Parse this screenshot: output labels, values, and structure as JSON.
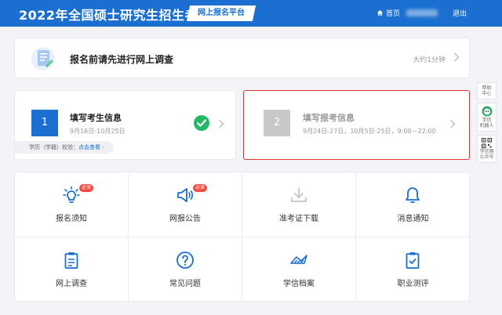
{
  "header": {
    "site_title": "2022年全国硕士研究生招生考试",
    "platform_badge": "网上报名平台",
    "home_label": "首页",
    "logout_label": "退出"
  },
  "survey": {
    "title": "报名前请先进行网上调查",
    "time_hint": "大约1分钟"
  },
  "steps": [
    {
      "number": "1",
      "title": "填写考生信息",
      "date": "9月16日-10月25日",
      "completed": true,
      "verify_prefix": "学历（学籍）校验：",
      "verify_link": "点击查看"
    },
    {
      "number": "2",
      "title": "填写报考信息",
      "date": "9月24日-27日，10月5日-25日，9:00－22:00",
      "completed": false
    }
  ],
  "side_tools": [
    {
      "label_1": "帮助",
      "label_2": "中心"
    },
    {
      "label_1": "学信",
      "label_2": "机器人"
    },
    {
      "label_1": "学信网",
      "label_2": "公众号"
    }
  ],
  "grid": [
    {
      "label": "报名须知",
      "icon": "lightbulb-icon",
      "tag": "必读"
    },
    {
      "label": "网报公告",
      "icon": "megaphone-icon",
      "tag": "必读"
    },
    {
      "label": "准考证下载",
      "icon": "download-icon",
      "tag": ""
    },
    {
      "label": "消息通知",
      "icon": "bell-icon",
      "tag": ""
    },
    {
      "label": "网上调查",
      "icon": "clipboard-icon",
      "tag": ""
    },
    {
      "label": "常见问题",
      "icon": "question-icon",
      "tag": ""
    },
    {
      "label": "学信档案",
      "icon": "archive-logo-icon",
      "tag": ""
    },
    {
      "label": "职业测评",
      "icon": "checklist-icon",
      "tag": ""
    }
  ],
  "colors": {
    "brand": "#1a6fd0",
    "success": "#25b864",
    "highlight_border": "#e0352b",
    "tag": "#f24a3d"
  }
}
